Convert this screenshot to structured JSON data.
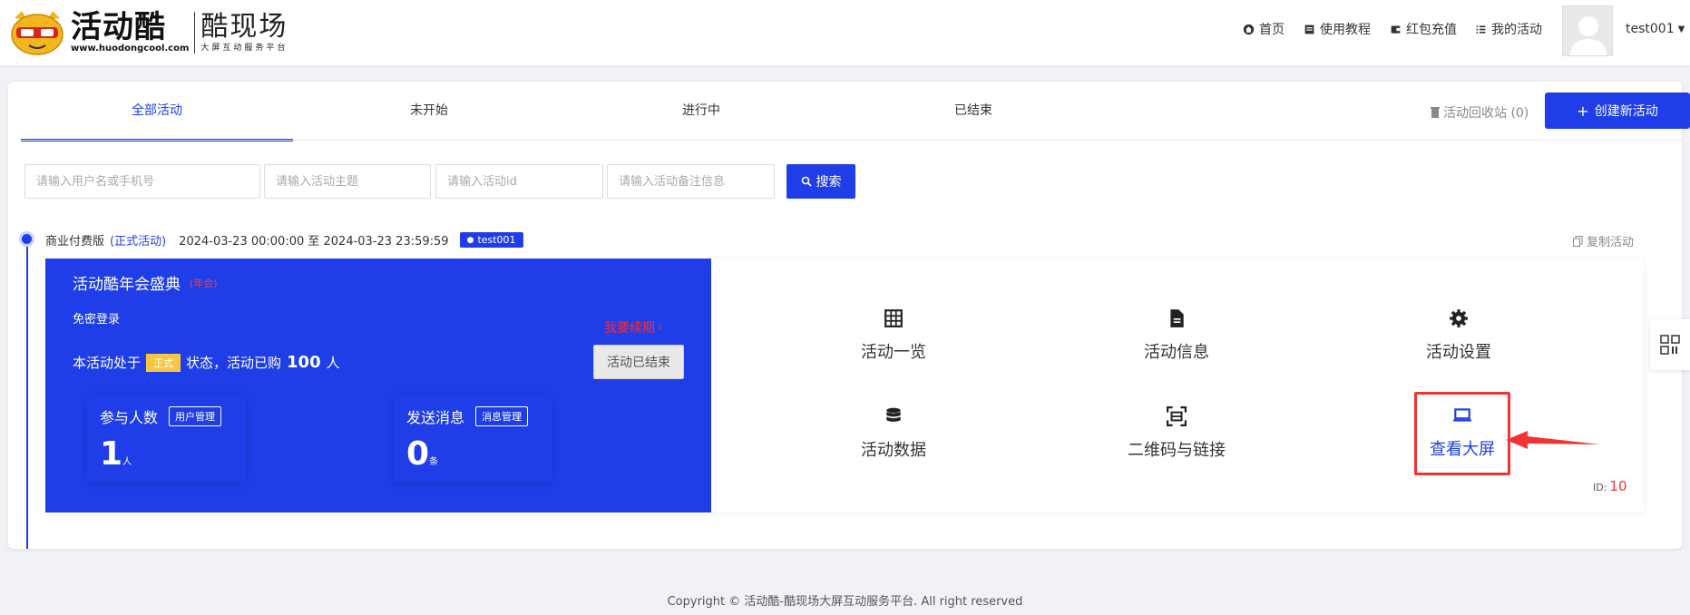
{
  "header": {
    "logo_title": "活动酷",
    "logo_url": "www.huodongcool.com",
    "logo_sub_title": "酷现场",
    "logo_sub_desc": "大屏互动服务平台",
    "nav": [
      {
        "label": "首页",
        "icon": "home-icon"
      },
      {
        "label": "使用教程",
        "icon": "book-icon"
      },
      {
        "label": "红包充值",
        "icon": "wallet-icon"
      },
      {
        "label": "我的活动",
        "icon": "list-icon"
      }
    ],
    "username": "test001"
  },
  "tabs": [
    {
      "label": "全部活动",
      "active": true
    },
    {
      "label": "未开始",
      "active": false
    },
    {
      "label": "进行中",
      "active": false
    },
    {
      "label": "已结束",
      "active": false
    }
  ],
  "recycle_label": "活动回收站 (0)",
  "create_button": "创建新活动",
  "search": {
    "user_placeholder": "请输入用户名或手机号",
    "topic_placeholder": "请输入活动主题",
    "id_placeholder": "请输入活动id",
    "note_placeholder": "请输入活动备注信息",
    "button": "搜索"
  },
  "event": {
    "edition": "商业付费版",
    "type_link": "(正式活动)",
    "time_range": "2024-03-23 00:00:00 至 2024-03-23 23:59:59",
    "owner": "test001",
    "copy_label": "复制活动",
    "title": "活动酷年会盛典",
    "tag": "(年会)",
    "login_mode": "免密登录",
    "help_link": "我要续期",
    "status_prefix": "本活动处于",
    "status_badge": "正式",
    "status_mid": "状态，活动已购",
    "purchased": "100",
    "status_suffix": "人",
    "ended_button": "活动已结束",
    "stats": [
      {
        "label": "参与人数",
        "button": "用户管理",
        "value": "1",
        "unit": "人"
      },
      {
        "label": "发送消息",
        "button": "消息管理",
        "value": "0",
        "unit": "条"
      }
    ],
    "actions": [
      {
        "label": "活动一览",
        "icon": "grid-icon"
      },
      {
        "label": "活动信息",
        "icon": "document-icon"
      },
      {
        "label": "活动设置",
        "icon": "gear-icon"
      },
      {
        "label": "活动数据",
        "icon": "database-icon"
      },
      {
        "label": "二维码与链接",
        "icon": "qrcode-scan-icon"
      },
      {
        "label": "查看大屏",
        "icon": "laptop-icon"
      }
    ],
    "id_label": "ID:",
    "id_value": "10"
  },
  "footer": "Copyright © 活动酷-酷现场大屏互动服务平台. All right reserved",
  "colors": {
    "primary": "#1f3ee8",
    "highlight": "#f03333",
    "badge": "#f7c83f"
  }
}
